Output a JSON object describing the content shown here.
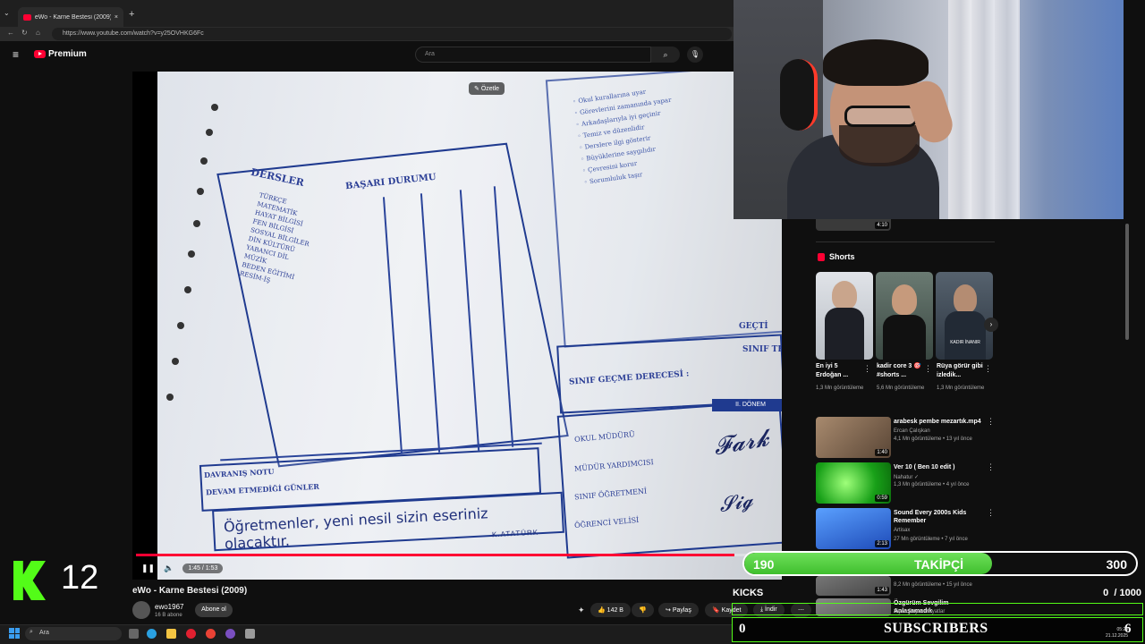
{
  "browser": {
    "tab_title": "eWo - Karne Bestesi (2009)",
    "url": "https://www.youtube.com/watch?v=y25OVHKG6Fc"
  },
  "youtube": {
    "logo": "Premium",
    "search_placeholder": "Ara",
    "video_title": "eWo - Karne Bestesi (2009)",
    "channel": "ewo1967",
    "subscribers": "16 B abone",
    "subscribe_label": "Abone ol",
    "likes": "142 B",
    "share": "Paylaş",
    "save": "Kaydet",
    "download": "İndir",
    "time": "1:45 / 1:53",
    "progress": 0.929,
    "summarize": "Özetle"
  },
  "video_content": {
    "section_header": "DERSLER",
    "status_header": "BAŞARI DURUMU",
    "behavior_header": "DAVRANIŞ NOTU",
    "attendance": "DEVAM ETMEDİĞİ GÜNLER",
    "note": "Öğretmenler, yeni nesil sizin eseriniz olacaktır.",
    "note_signature": "K.ATATÜRK",
    "passed": "GEÇTİ",
    "failed": "SINIF TEKRARI",
    "class_degree": "SINIF GEÇME DERECESİ :",
    "term": "II. DÖNEM",
    "roles": [
      "OKUL MÜDÜRÜ",
      "MÜDÜR YARDIMCISI",
      "SINIF ÖĞRETMENİ",
      "ÖĞRENCİ VELİSİ"
    ]
  },
  "sidebar": {
    "top_duration": "4:10",
    "shorts_title": "Shorts",
    "shorts": [
      {
        "title": "En iyi 5 Erdoğan ...",
        "views": "1,3 Mn görüntüleme",
        "color": "#cfd3d8"
      },
      {
        "title": "kadir core 3 🎯 #shorts ...",
        "views": "5,6 Mn görüntüleme",
        "color": "#6d7a74"
      },
      {
        "title": "Rüya görür gibi izledik...",
        "views": "1,3 Mn görüntüleme",
        "color": "#4a5a66",
        "caption": "KADIR İNANIR"
      }
    ],
    "recommended": [
      {
        "title": "arabesk pembe mezartık.mp4",
        "channel": "Ercan Çalışkan",
        "meta": "4,1 Mn görüntüleme • 13 yıl önce",
        "duration": "1:40",
        "color": "#8a6d55"
      },
      {
        "title": "Ver 10 ( Ben 10 edit )",
        "channel": "Nahatur ✓",
        "meta": "1,3 Mn görüntüleme • 4 yıl önce",
        "duration": "0:59",
        "color": "#2fbf2f"
      },
      {
        "title": "Sound Every 2000s Kids Remember",
        "channel": "Artisax",
        "meta": "27 Mn görüntüleme • 7 yıl önce",
        "duration": "2:13",
        "color": "#2e5fd0"
      },
      {
        "title": "",
        "channel": "",
        "meta": "8,2 Mn görüntüleme • 15 yıl önce",
        "duration": "1:43",
        "color": "#555"
      },
      {
        "title": "Özgürüm Sevgilim Anlaşamadık",
        "channel": "Siyah Beyaz Hayatlar",
        "meta": "",
        "duration": "",
        "color": "#777"
      }
    ]
  },
  "overlay": {
    "kick_count": "12",
    "followers_current": "190",
    "followers_label": "TAKİPÇİ",
    "followers_goal": "300",
    "followers_fraction": 0.633,
    "kicks_label": "KICKS",
    "kicks_current": "0",
    "kicks_goal": "1000",
    "subs_current": "0",
    "subs_label": "SUBSCRIBERS",
    "subs_goal": "6"
  },
  "taskbar": {
    "search": "Ara",
    "time": "05:20",
    "date": "21.12.2025"
  }
}
